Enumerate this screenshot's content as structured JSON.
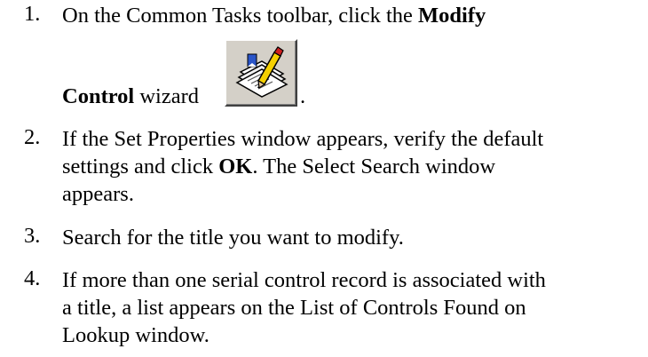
{
  "steps": [
    {
      "number": "1.",
      "line1_prefix": "On the Common Tasks toolbar, click the ",
      "line1_bold": "Modify",
      "line2_bold": "Control",
      "line2_suffix": " wizard",
      "icon": "modify-control-wizard-icon",
      "trailing": "."
    },
    {
      "number": "2.",
      "line1": "If the Set Properties window appears, verify the default",
      "line2_prefix": "settings and click ",
      "line2_bold": "OK",
      "line2_suffix": ". The Select Search window",
      "line3": "appears."
    },
    {
      "number": "3.",
      "line1": "Search for the title you want to modify."
    },
    {
      "number": "4.",
      "line1": "If more than one serial control record is associated with",
      "line2": "a title, a list appears on the List of Controls Found on",
      "line3": "Lookup window."
    }
  ]
}
